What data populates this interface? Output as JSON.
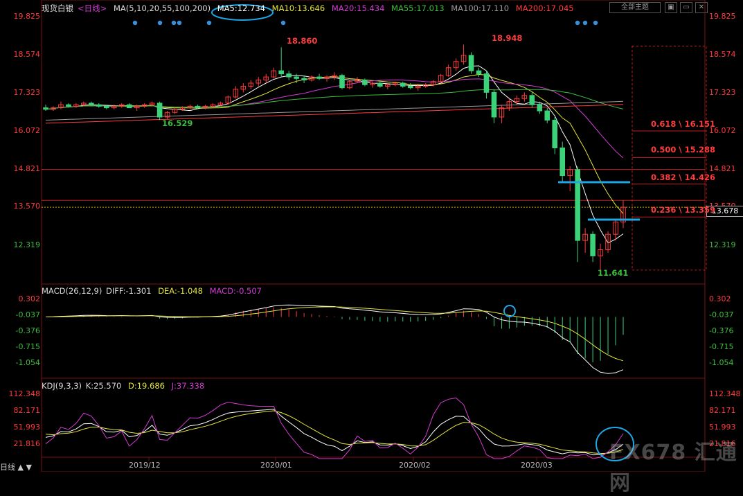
{
  "header": {
    "symbol": "现货白银",
    "period": "<日线>",
    "ma_group": "MA(5,10,20,55,100,200)",
    "ma5": "MA5:12.734",
    "ma10": "MA10:13.646",
    "ma20": "MA20:15.434",
    "ma55": "MA55:17.013",
    "ma100": "MA100:17.110",
    "ma200": "MA200:17.045",
    "theme_button": "全部主题",
    "colors": {
      "ma5": "#ffffff",
      "ma10": "#e6e63c",
      "ma20": "#d33cd3",
      "ma55": "#3cbf3c",
      "ma100": "#9a9a9a",
      "ma200": "#ff3b3b"
    }
  },
  "toolbar_icons": [
    "expand-icon",
    "minimize-icon",
    "close-icon"
  ],
  "price_axis": {
    "left_ticks": [
      "19.825",
      "18.574",
      "17.323",
      "16.072",
      "14.821",
      "13.570",
      "12.319"
    ],
    "right_ticks": [
      "19.825",
      "18.574",
      "17.323",
      "16.072",
      "14.821",
      "13.570",
      "12.319"
    ],
    "current_price": "13.678"
  },
  "annotations": {
    "high1": "18.860",
    "high2": "18.948",
    "low1": "16.529",
    "low2": "11.641"
  },
  "fibonacci": [
    {
      "label": "0.618 \\ 16.151",
      "price": 16.151
    },
    {
      "label": "0.500 \\ 15.288",
      "price": 15.288
    },
    {
      "label": "0.382 \\ 14.426",
      "price": 14.426
    },
    {
      "label": "0.236 \\ 13.359",
      "price": 13.359
    }
  ],
  "macd": {
    "title": "MACD(26,12,9)",
    "diff": "DIFF:-1.301",
    "dea": "DEA:-1.048",
    "macd": "MACD:-0.507",
    "ticks": [
      "0.302",
      "-0.037",
      "-0.376",
      "-0.715",
      "-1.054"
    ]
  },
  "kdj": {
    "title": "KDJ(9,3,3)",
    "k": "K:25.570",
    "d": "D:19.686",
    "j": "J:37.338",
    "ticks": [
      "112.348",
      "82.171",
      "51.993",
      "21.816"
    ]
  },
  "x_axis": [
    "2019/12",
    "2020/01",
    "2020/02",
    "2020/03"
  ],
  "footer": {
    "period_tab": "日线"
  },
  "watermark": "FX678 汇通网",
  "chart_data": {
    "type": "candlestick",
    "title": "现货白银 日线",
    "ylim": [
      11.3,
      19.9
    ],
    "series": [
      {
        "name": "price",
        "x_labels_months": [
          "2019/12",
          "2020/01",
          "2020/02",
          "2020/03"
        ],
        "ohlc_approx": [
          [
            16.9,
            17.0,
            16.8,
            16.85
          ],
          [
            16.85,
            16.95,
            16.8,
            16.9
          ],
          [
            16.9,
            17.1,
            16.85,
            17.0
          ],
          [
            17.0,
            17.05,
            16.9,
            16.95
          ],
          [
            16.95,
            17.05,
            16.9,
            17.0
          ],
          [
            17.0,
            17.1,
            16.95,
            17.05
          ],
          [
            17.05,
            17.1,
            16.95,
            17.0
          ],
          [
            17.0,
            17.05,
            16.9,
            16.95
          ],
          [
            16.95,
            17.0,
            16.85,
            16.9
          ],
          [
            16.9,
            17.0,
            16.85,
            16.95
          ],
          [
            16.95,
            17.05,
            16.9,
            17.0
          ],
          [
            17.0,
            17.05,
            16.9,
            16.9
          ],
          [
            16.9,
            17.0,
            16.8,
            16.95
          ],
          [
            16.95,
            17.05,
            16.9,
            17.0
          ],
          [
            17.0,
            17.1,
            16.95,
            17.05
          ],
          [
            17.05,
            17.1,
            16.5,
            16.6
          ],
          [
            16.6,
            16.8,
            16.53,
            16.75
          ],
          [
            16.75,
            16.9,
            16.7,
            16.85
          ],
          [
            16.85,
            16.95,
            16.8,
            16.9
          ],
          [
            16.9,
            17.0,
            16.85,
            16.95
          ],
          [
            16.95,
            17.0,
            16.85,
            16.9
          ],
          [
            16.9,
            17.0,
            16.85,
            16.95
          ],
          [
            16.95,
            17.05,
            16.9,
            17.0
          ],
          [
            17.0,
            17.1,
            16.95,
            17.05
          ],
          [
            17.05,
            17.3,
            17.0,
            17.25
          ],
          [
            17.25,
            17.6,
            17.2,
            17.5
          ],
          [
            17.5,
            17.7,
            17.4,
            17.6
          ],
          [
            17.6,
            17.8,
            17.5,
            17.7
          ],
          [
            17.7,
            17.9,
            17.6,
            17.8
          ],
          [
            17.8,
            18.0,
            17.7,
            17.9
          ],
          [
            17.9,
            18.2,
            17.85,
            18.1
          ],
          [
            18.1,
            18.86,
            17.9,
            18.0
          ],
          [
            18.0,
            18.1,
            17.8,
            17.9
          ],
          [
            17.9,
            18.0,
            17.7,
            17.85
          ],
          [
            17.85,
            17.95,
            17.7,
            17.8
          ],
          [
            17.8,
            17.95,
            17.75,
            17.9
          ],
          [
            17.9,
            18.0,
            17.8,
            17.85
          ],
          [
            17.85,
            17.95,
            17.75,
            17.9
          ],
          [
            17.9,
            18.05,
            17.8,
            17.95
          ],
          [
            17.95,
            18.0,
            17.5,
            17.55
          ],
          [
            17.55,
            17.8,
            17.5,
            17.75
          ],
          [
            17.75,
            17.9,
            17.7,
            17.8
          ],
          [
            17.8,
            17.85,
            17.6,
            17.65
          ],
          [
            17.65,
            17.75,
            17.55,
            17.7
          ],
          [
            17.7,
            17.75,
            17.55,
            17.6
          ],
          [
            17.6,
            17.7,
            17.5,
            17.65
          ],
          [
            17.65,
            17.75,
            17.6,
            17.7
          ],
          [
            17.7,
            17.75,
            17.55,
            17.6
          ],
          [
            17.6,
            17.7,
            17.5,
            17.55
          ],
          [
            17.55,
            17.65,
            17.45,
            17.6
          ],
          [
            17.6,
            17.7,
            17.55,
            17.65
          ],
          [
            17.65,
            17.8,
            17.6,
            17.75
          ],
          [
            17.75,
            18.0,
            17.7,
            17.95
          ],
          [
            17.95,
            18.3,
            17.9,
            18.2
          ],
          [
            18.2,
            18.5,
            18.1,
            18.4
          ],
          [
            18.4,
            18.948,
            18.3,
            18.6
          ],
          [
            18.6,
            18.7,
            18.0,
            18.1
          ],
          [
            18.1,
            18.2,
            17.9,
            18.0
          ],
          [
            18.0,
            18.1,
            17.2,
            17.4
          ],
          [
            17.4,
            17.5,
            16.4,
            16.6
          ],
          [
            16.6,
            17.0,
            16.4,
            16.9
          ],
          [
            16.9,
            17.2,
            16.8,
            17.1
          ],
          [
            17.1,
            17.3,
            17.0,
            17.2
          ],
          [
            17.2,
            17.4,
            17.1,
            17.3
          ],
          [
            17.3,
            17.4,
            16.9,
            17.0
          ],
          [
            17.0,
            17.1,
            16.7,
            16.8
          ],
          [
            16.8,
            16.9,
            16.4,
            16.5
          ],
          [
            16.5,
            16.6,
            15.4,
            15.6
          ],
          [
            15.6,
            15.8,
            14.5,
            14.7
          ],
          [
            14.7,
            15.0,
            14.2,
            14.9
          ],
          [
            14.9,
            15.0,
            11.9,
            12.6
          ],
          [
            12.6,
            13.0,
            12.2,
            12.8
          ],
          [
            12.8,
            12.9,
            11.9,
            12.1
          ],
          [
            12.1,
            12.5,
            11.641,
            12.3
          ],
          [
            12.3,
            12.9,
            12.2,
            12.8
          ],
          [
            12.8,
            13.3,
            12.6,
            13.2
          ],
          [
            13.2,
            13.9,
            13.0,
            13.678
          ]
        ]
      },
      {
        "name": "MA5",
        "value": 12.734
      },
      {
        "name": "MA10",
        "value": 13.646
      },
      {
        "name": "MA20",
        "value": 15.434
      },
      {
        "name": "MA55",
        "value": 17.013
      },
      {
        "name": "MA100",
        "value": 17.11
      },
      {
        "name": "MA200",
        "value": 17.045
      }
    ],
    "horizontal_lines": [
      14.9,
      13.9,
      13.678
    ],
    "macd_ylim": [
      -1.35,
      0.45
    ],
    "kdj_ylim": [
      5,
      125
    ]
  }
}
